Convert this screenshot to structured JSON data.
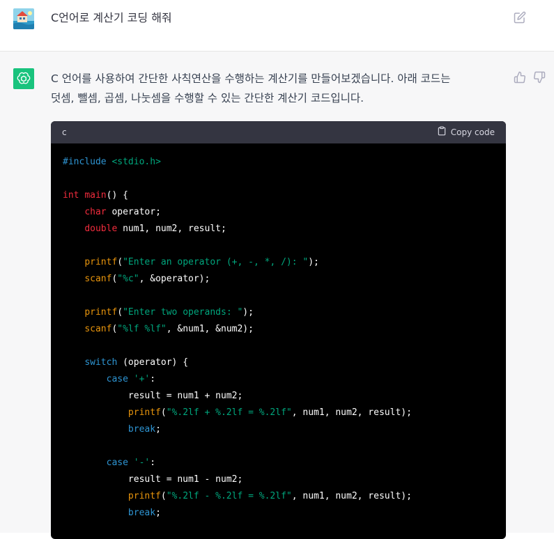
{
  "user_message": {
    "text": "C언어로 계산기 코딩 해줘"
  },
  "assistant_message": {
    "line1": "C 언어를 사용하여 간단한 사칙연산을 수행하는 계산기를 만들어보겠습니다. 아래 코드는",
    "line2": "덧셈, 뺄셈, 곱셈, 나눗셈을 수행할 수 있는 간단한 계산기 코드입니다."
  },
  "code_block": {
    "language": "c",
    "copy_label": "Copy code",
    "lines": [
      [
        {
          "t": "#include ",
          "c": "k-blue"
        },
        {
          "t": "<stdio.h>",
          "c": "k-green"
        }
      ],
      [],
      [
        {
          "t": "int",
          "c": "k-red"
        },
        {
          "t": " ",
          "c": "k-white"
        },
        {
          "t": "main",
          "c": "k-red"
        },
        {
          "t": "() {",
          "c": "k-white"
        }
      ],
      [
        {
          "t": "    ",
          "c": "k-white"
        },
        {
          "t": "char",
          "c": "k-red"
        },
        {
          "t": " operator;",
          "c": "k-white"
        }
      ],
      [
        {
          "t": "    ",
          "c": "k-white"
        },
        {
          "t": "double",
          "c": "k-red"
        },
        {
          "t": " num1, num2, result;",
          "c": "k-white"
        }
      ],
      [],
      [
        {
          "t": "    ",
          "c": "k-white"
        },
        {
          "t": "printf",
          "c": "k-orange"
        },
        {
          "t": "(",
          "c": "k-white"
        },
        {
          "t": "\"Enter an operator (+, -, *, /): \"",
          "c": "k-green"
        },
        {
          "t": ");",
          "c": "k-white"
        }
      ],
      [
        {
          "t": "    ",
          "c": "k-white"
        },
        {
          "t": "scanf",
          "c": "k-orange"
        },
        {
          "t": "(",
          "c": "k-white"
        },
        {
          "t": "\"%c\"",
          "c": "k-green"
        },
        {
          "t": ", &operator);",
          "c": "k-white"
        }
      ],
      [],
      [
        {
          "t": "    ",
          "c": "k-white"
        },
        {
          "t": "printf",
          "c": "k-orange"
        },
        {
          "t": "(",
          "c": "k-white"
        },
        {
          "t": "\"Enter two operands: \"",
          "c": "k-green"
        },
        {
          "t": ");",
          "c": "k-white"
        }
      ],
      [
        {
          "t": "    ",
          "c": "k-white"
        },
        {
          "t": "scanf",
          "c": "k-orange"
        },
        {
          "t": "(",
          "c": "k-white"
        },
        {
          "t": "\"%lf %lf\"",
          "c": "k-green"
        },
        {
          "t": ", &num1, &num2);",
          "c": "k-white"
        }
      ],
      [],
      [
        {
          "t": "    ",
          "c": "k-white"
        },
        {
          "t": "switch",
          "c": "k-blue"
        },
        {
          "t": " (operator) {",
          "c": "k-white"
        }
      ],
      [
        {
          "t": "        ",
          "c": "k-white"
        },
        {
          "t": "case",
          "c": "k-blue"
        },
        {
          "t": " ",
          "c": "k-white"
        },
        {
          "t": "'+'",
          "c": "k-green"
        },
        {
          "t": ":",
          "c": "k-white"
        }
      ],
      [
        {
          "t": "            result = num1 + num2;",
          "c": "k-white"
        }
      ],
      [
        {
          "t": "            ",
          "c": "k-white"
        },
        {
          "t": "printf",
          "c": "k-orange"
        },
        {
          "t": "(",
          "c": "k-white"
        },
        {
          "t": "\"%.2lf + %.2lf = %.2lf\"",
          "c": "k-green"
        },
        {
          "t": ", num1, num2, result);",
          "c": "k-white"
        }
      ],
      [
        {
          "t": "            ",
          "c": "k-white"
        },
        {
          "t": "break",
          "c": "k-blue"
        },
        {
          "t": ";",
          "c": "k-white"
        }
      ],
      [],
      [
        {
          "t": "        ",
          "c": "k-white"
        },
        {
          "t": "case",
          "c": "k-blue"
        },
        {
          "t": " ",
          "c": "k-white"
        },
        {
          "t": "'-'",
          "c": "k-green"
        },
        {
          "t": ":",
          "c": "k-white"
        }
      ],
      [
        {
          "t": "            result = num1 - num2;",
          "c": "k-white"
        }
      ],
      [
        {
          "t": "            ",
          "c": "k-white"
        },
        {
          "t": "printf",
          "c": "k-orange"
        },
        {
          "t": "(",
          "c": "k-white"
        },
        {
          "t": "\"%.2lf - %.2lf = %.2lf\"",
          "c": "k-green"
        },
        {
          "t": ", num1, num2, result);",
          "c": "k-white"
        }
      ],
      [
        {
          "t": "            ",
          "c": "k-white"
        },
        {
          "t": "break",
          "c": "k-blue"
        },
        {
          "t": ";",
          "c": "k-white"
        }
      ]
    ]
  },
  "icons": {
    "user_avatar": "user-avatar-image",
    "assistant_avatar": "openai-logo-icon",
    "edit": "edit-icon",
    "thumbs_up": "thumbs-up-icon",
    "thumbs_down": "thumbs-down-icon",
    "clipboard": "clipboard-icon"
  },
  "colors": {
    "assistant_bg": "#f7f7f8",
    "avatar_green": "#19c37d",
    "code_bg": "#000000",
    "code_header_bg": "#343541"
  }
}
